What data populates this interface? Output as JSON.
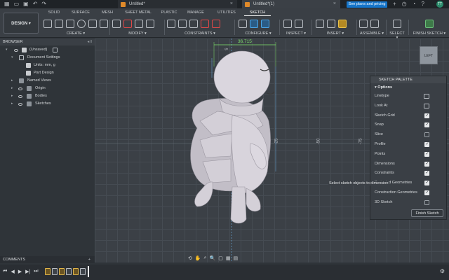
{
  "titlebar": {
    "tab1_title": "Untitled*",
    "tab2_title": "Untitled*(1)",
    "plans_button": "See plans and pricing",
    "avatar_initials": "TT",
    "close_x": "×"
  },
  "toolbar": {
    "design_label": "DESIGN ▾",
    "workspace_tabs": [
      "SOLID",
      "SURFACE",
      "MESH",
      "SHEET METAL",
      "PLASTIC",
      "MANAGE",
      "UTILITIES",
      "SKETCH"
    ],
    "groups": {
      "create": "CREATE ▾",
      "modify": "MODIFY ▾",
      "constraints": "CONSTRAINTS ▾",
      "configure": "CONFIGURE ▾",
      "inspect": "INSPECT ▾",
      "insert": "INSERT ▾",
      "assemble": "ASSEMBLE ▾",
      "select": "SELECT ▾",
      "finish": "FINISH SKETCH ▾"
    }
  },
  "browser": {
    "title": "BROWSER",
    "controls": "◂ ‖",
    "items": [
      {
        "label": "(Unsaved)",
        "icon": "document-icon"
      },
      {
        "label": "Document Settings",
        "icon": "gear-icon"
      },
      {
        "label": "Units: mm, g",
        "icon": "document-icon"
      },
      {
        "label": "Part Design",
        "icon": "document-icon"
      },
      {
        "label": "Named Views",
        "icon": "folder-icon"
      },
      {
        "label": "Origin",
        "icon": "folder-icon"
      },
      {
        "label": "Bodies",
        "icon": "folder-icon"
      },
      {
        "label": "Sketches",
        "icon": "folder-icon"
      }
    ]
  },
  "viewport": {
    "dimension_value": "36.715",
    "dimension_small": "5",
    "axis_labels": [
      "-25",
      "-50",
      "-75"
    ],
    "view_cube_label": "LEFT"
  },
  "sketch_palette": {
    "title": "SKETCH PALETTE",
    "options_header": "▾ Options",
    "rows": [
      {
        "label": "Linetype",
        "kind": "icon"
      },
      {
        "label": "Look At",
        "kind": "icon"
      },
      {
        "label": "Sketch Grid",
        "checked": true
      },
      {
        "label": "Snap",
        "checked": true
      },
      {
        "label": "Slice",
        "checked": false
      },
      {
        "label": "Profile",
        "checked": true
      },
      {
        "label": "Points",
        "checked": true
      },
      {
        "label": "Dimensions",
        "checked": true
      },
      {
        "label": "Constraints",
        "checked": true
      },
      {
        "label": "Projected Geometries",
        "checked": true
      },
      {
        "label": "Construction Geometries",
        "checked": true
      },
      {
        "label": "3D Sketch",
        "checked": false
      }
    ],
    "finish_button": "Finish Sketch"
  },
  "tooltip": "Select sketch objects to dimension",
  "comments": {
    "title": "COMMENTS",
    "plus": "+"
  },
  "navbar": {
    "icons": [
      "⟲",
      "✋",
      "⌕",
      "🔍",
      "▢",
      "▦",
      "▤"
    ]
  },
  "timeline": {
    "controls": [
      "⏮",
      "◀",
      "▶",
      "▶|",
      "⏭"
    ],
    "gear": "⚙"
  },
  "colors": {
    "dimension": "#7fe36b",
    "accent": "#1675c9",
    "cube_icon": "#e08a2a"
  }
}
